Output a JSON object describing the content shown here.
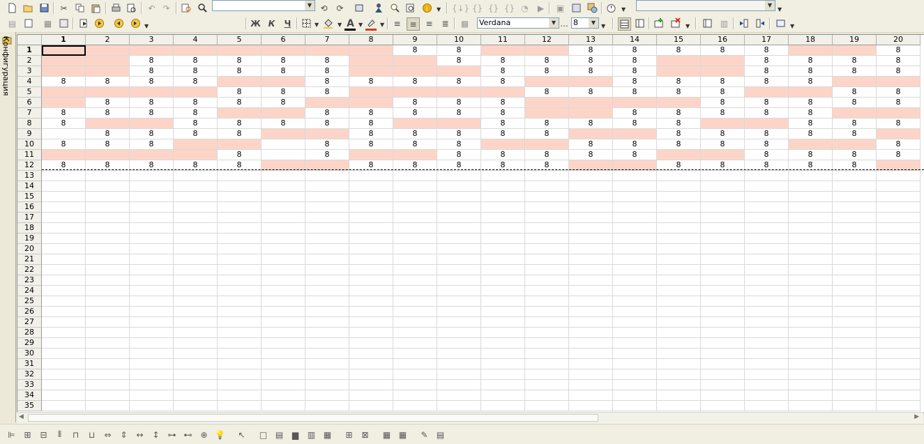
{
  "toolbar1": {
    "items": [
      "new-doc-icon",
      "open-folder-icon",
      "save-icon",
      "cut-icon",
      "copy-icon",
      "paste-icon",
      "print-icon",
      "print-preview-icon",
      "undo-icon",
      "redo-icon",
      "find-in-module-icon",
      "search-icon"
    ],
    "search_combo_value": "",
    "items2": [
      "find-next-icon",
      "find-prev-icon",
      "window-icon",
      "designer-icon",
      "syntax-assistant-icon",
      "module-icon",
      "info-icon"
    ],
    "items3": [
      "debug-icon",
      "step-into-icon",
      "step-over-icon",
      "breakpoint-icon",
      "run-icon",
      "stop-icon",
      "window2-icon",
      "window3-icon",
      "config-icon",
      "timer-icon"
    ],
    "right_combo_value": ""
  },
  "toolbar2": {
    "bold_label": "Ж",
    "italic_label": "К",
    "underline_label": "Ч",
    "font_name": "Verdana",
    "font_more": "...",
    "font_size": "8",
    "text_color": "#000000",
    "highlight_color": "#d23c1e"
  },
  "side_panel": {
    "label": "Конфигурация"
  },
  "sheet": {
    "active_cell": "R1C1",
    "value_text": "8",
    "columns": [
      "1",
      "2",
      "3",
      "4",
      "5",
      "6",
      "7",
      "8",
      "9",
      "10",
      "11",
      "12",
      "13",
      "14",
      "15",
      "16",
      "17",
      "18",
      "19",
      "20"
    ],
    "rows": [
      "1",
      "2",
      "3",
      "4",
      "5",
      "6",
      "7",
      "8",
      "9",
      "10",
      "11",
      "12",
      "13",
      "14",
      "15",
      "16",
      "17",
      "18",
      "19",
      "20",
      "21",
      "22",
      "23",
      "24",
      "25",
      "26",
      "27",
      "28",
      "29",
      "30",
      "31",
      "32",
      "33",
      "34",
      "35"
    ],
    "cell_map": [
      "PPPPPPPPvvPPvvvvvPPv",
      "PPvvvvvPPvvvvvPPvvvv",
      "PPvvvvvPPPvvvvPPvvvv",
      "vvvvPPvvvvvPPvvvvvPP",
      "PPPPvvvPPPPvvvvvPPvv",
      "PvvvvvPPvvvPPPPvvvvv",
      "vvvvPPvvvvvPPvvvvvPP",
      "vPPvvvvvPPvvvvvPPvvv",
      "wvvvvPPvvvvvPPvvvvvP",
      "vvvPPwvvvvPPvvvvvPPv",
      "PPPPvwvPPvvvvvPPvvvv",
      "vvvvvPPvvvvvPPvvvvvP"
    ],
    "legend_note": ""
  },
  "colors": {
    "pink": "#fcd5c8",
    "grid": "#d9d9d9",
    "header_bg": "#f1f0e9"
  },
  "toolbar3": {
    "items": [
      "align-left-icon",
      "align-center-h-icon",
      "align-right-icon",
      "align-top-icon",
      "align-middle-icon",
      "align-bottom-icon",
      "same-width-icon",
      "same-height-icon",
      "space-h-icon",
      "space-v-icon",
      "center-h-icon",
      "center-v-icon",
      "center-both-icon",
      "lightbulb-icon",
      "pointer-icon",
      "rect-icon",
      "text-icon",
      "picture-icon",
      "chart-icon",
      "table-icon",
      "add-row-icon",
      "delete-row-icon",
      "grid-icon",
      "grid2-icon",
      "edit-icon",
      "table2-icon"
    ]
  }
}
